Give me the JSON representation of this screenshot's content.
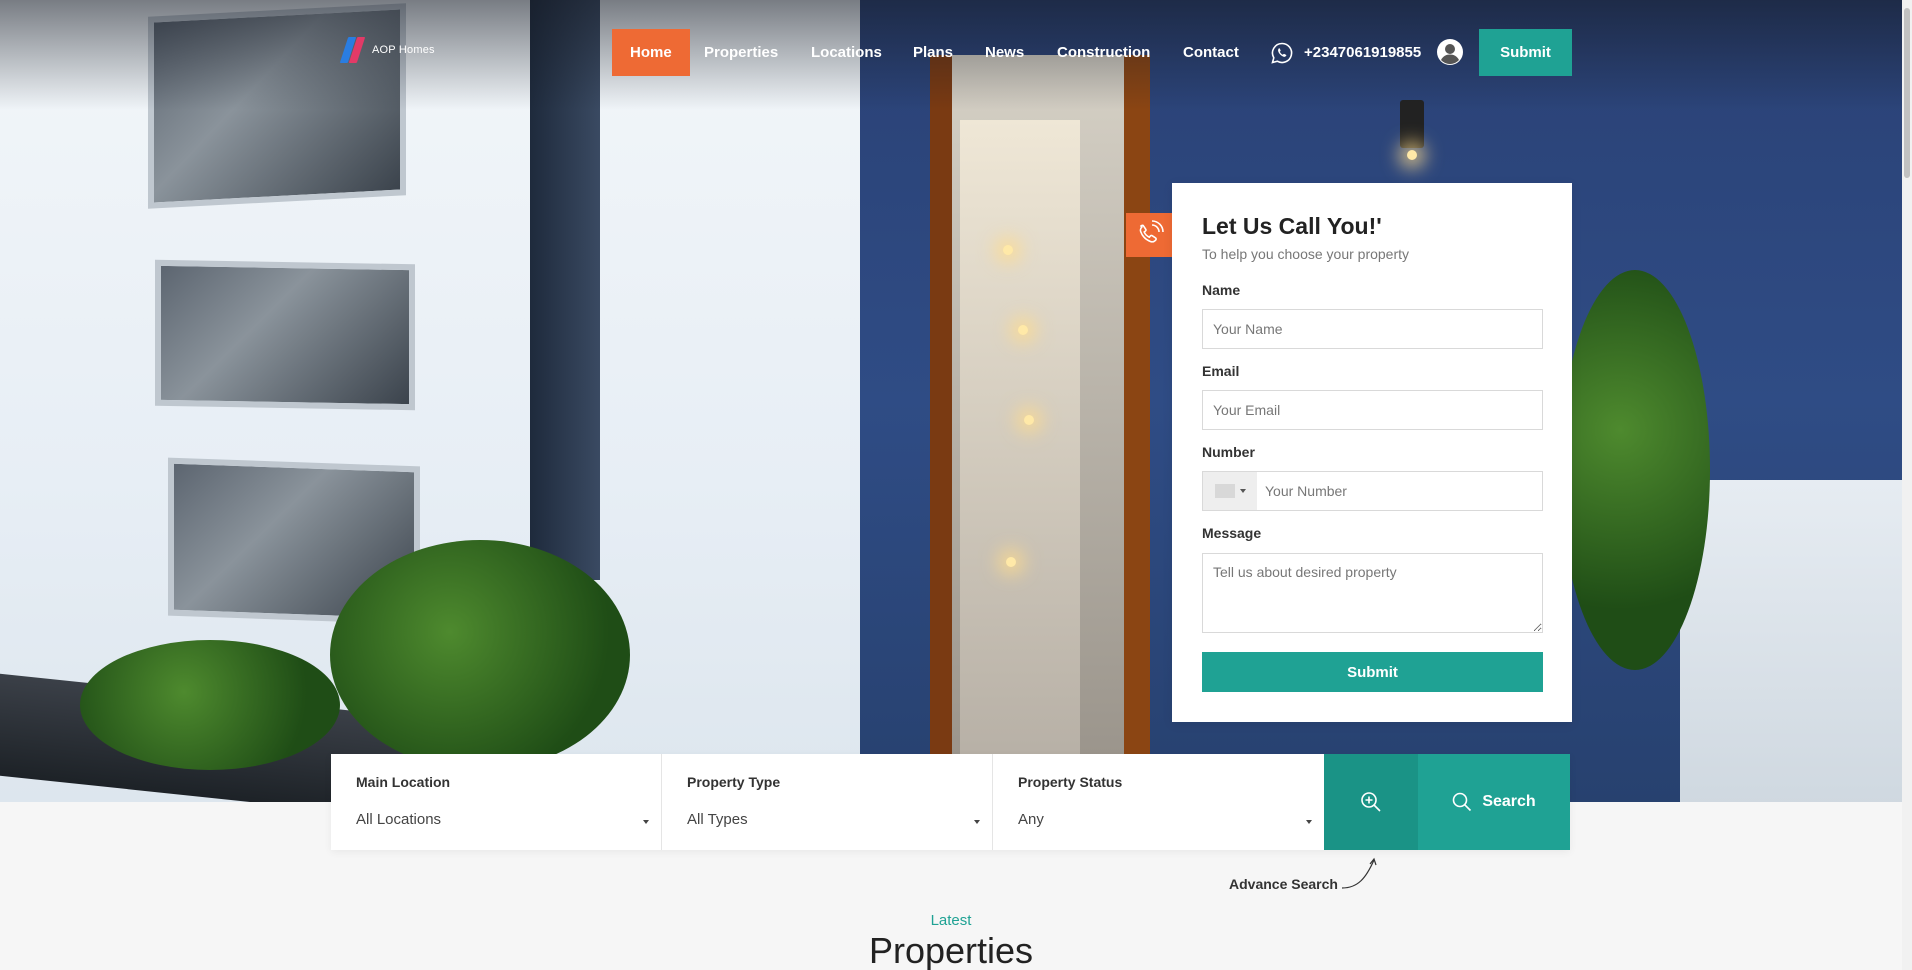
{
  "brand": {
    "logo_text": "AOP Homes"
  },
  "nav": {
    "items": [
      {
        "label": "Home",
        "active": true
      },
      {
        "label": "Properties"
      },
      {
        "label": "Locations"
      },
      {
        "label": "Plans"
      },
      {
        "label": "News"
      },
      {
        "label": "Construction"
      },
      {
        "label": "Contact"
      }
    ],
    "phone": "+2347061919855",
    "phone_icon": "whatsapp-icon",
    "user_icon": "user-avatar-icon",
    "submit_label": "Submit"
  },
  "call_form": {
    "badge_icon": "phone-call-icon",
    "title": "Let Us Call You!'",
    "subtitle": "To help you choose your property",
    "name_label": "Name",
    "name_placeholder": "Your Name",
    "email_label": "Email",
    "email_placeholder": "Your Email",
    "number_label": "Number",
    "number_placeholder": "Your Number",
    "message_label": "Message",
    "message_placeholder": "Tell us about desired property",
    "submit_label": "Submit"
  },
  "search": {
    "fields": [
      {
        "label": "Main Location",
        "value": "All Locations"
      },
      {
        "label": "Property Type",
        "value": "All Types"
      },
      {
        "label": "Property Status",
        "value": "Any"
      }
    ],
    "advanced_icon": "zoom-in-icon",
    "search_label": "Search",
    "search_icon": "search-icon",
    "advance_search_label": "Advance Search"
  },
  "section": {
    "kicker": "Latest",
    "heading": "Properties"
  },
  "colors": {
    "accent_orange": "#ee6a34",
    "accent_teal": "#1fa294"
  }
}
